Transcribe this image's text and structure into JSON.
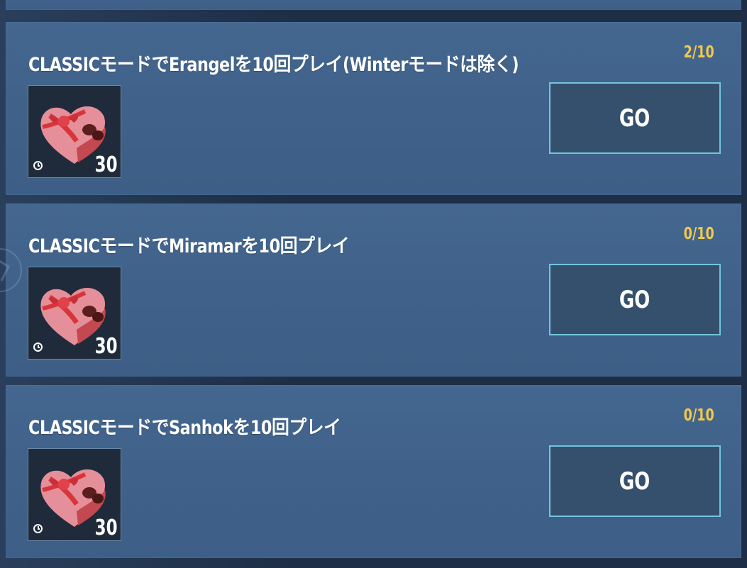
{
  "missions": [
    {
      "title": "CLASSICモードでErangelを10回プレイ(Winterモードは除く)",
      "progress": "2/10",
      "reward": {
        "icon": "heart-chocolate-box-icon",
        "count": "30"
      },
      "button_label": "GO"
    },
    {
      "title": "CLASSICモードでMiramarを10回プレイ",
      "progress": "0/10",
      "reward": {
        "icon": "heart-chocolate-box-icon",
        "count": "30"
      },
      "button_label": "GO"
    },
    {
      "title": "CLASSICモードでSanhokを10回プレイ",
      "progress": "0/10",
      "reward": {
        "icon": "heart-chocolate-box-icon",
        "count": "30"
      },
      "button_label": "GO"
    }
  ],
  "colors": {
    "progress": "#f2c84b",
    "button_border": "#72c5db",
    "card_bg": "#42648c"
  }
}
